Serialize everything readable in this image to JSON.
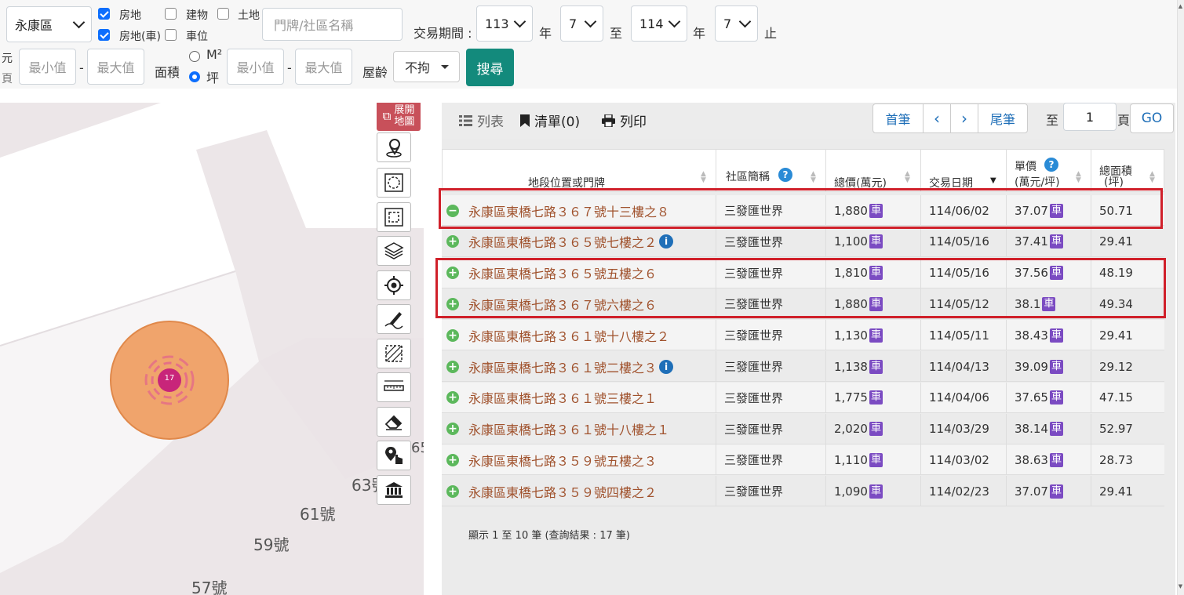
{
  "filters": {
    "district": "永康區",
    "cb_land_building": "房地",
    "cb_building": "建物",
    "cb_land": "土地",
    "cb_land_building_parking": "房地(車)",
    "cb_parking": "車位",
    "address_placeholder": "門牌/社區名稱",
    "period_label": "交易期間 :",
    "year_from": "113",
    "month_from": "7",
    "year_unit": "年",
    "to": "至",
    "year_to": "114",
    "month_to": "7",
    "end": "止",
    "price_unit_partial_1": "元",
    "price_unit_partial_2": "頁",
    "min_placeholder": "最小值",
    "max_placeholder": "最大值",
    "dash": "-",
    "area_label": "面積",
    "unit_m2": "M²",
    "unit_ping": "坪",
    "age_label": "屋齡",
    "age_value": "不拘",
    "search_button": "搜尋"
  },
  "map": {
    "expand_label_1": "展開",
    "expand_label_2": "地圖",
    "cluster_count": "17",
    "street_labels": [
      "63號",
      "61號",
      "59號",
      "57號",
      "65"
    ]
  },
  "toolbar": {
    "list_label": "列表",
    "bookmark_label": "清單(0)",
    "print_label": "列印"
  },
  "pagination": {
    "first": "首筆",
    "prev": "‹",
    "next": "›",
    "last": "尾筆",
    "to_label": "至",
    "page_value": "1",
    "page_unit": "頁",
    "go": "GO"
  },
  "table": {
    "headers": {
      "address": "地段位置或門牌",
      "community": "社區簡稱",
      "total_price": "總價(萬元)",
      "date": "交易日期",
      "unit_price_1": "單價",
      "unit_price_2": "(萬元/坪)",
      "area_1": "總面積",
      "area_2": "(坪)"
    },
    "parking_tag": "車",
    "rows": [
      {
        "address": "永康區東橋七路３６７號十三樓之８",
        "community": "三發匯世界",
        "total": "1,880",
        "date": "114/06/02",
        "unit": "37.07",
        "area": "50.71"
      },
      {
        "address": "永康區東橋七路３６５號七樓之２",
        "community": "三發匯世界",
        "total": "1,100",
        "date": "114/05/16",
        "unit": "37.41",
        "area": "29.41"
      },
      {
        "address": "永康區東橋七路３６５號五樓之６",
        "community": "三發匯世界",
        "total": "1,810",
        "date": "114/05/16",
        "unit": "37.56",
        "area": "48.19"
      },
      {
        "address": "永康區東橋七路３６７號六樓之６",
        "community": "三發匯世界",
        "total": "1,880",
        "date": "114/05/12",
        "unit": "38.1",
        "area": "49.34"
      },
      {
        "address": "永康區東橋七路３６１號十八樓之２",
        "community": "三發匯世界",
        "total": "1,130",
        "date": "114/05/11",
        "unit": "38.43",
        "area": "29.41"
      },
      {
        "address": "永康區東橋七路３６１號二樓之３",
        "community": "三發匯世界",
        "total": "1,138",
        "date": "114/04/13",
        "unit": "39.09",
        "area": "29.12"
      },
      {
        "address": "永康區東橋七路３６１號三樓之１",
        "community": "三發匯世界",
        "total": "1,775",
        "date": "114/04/06",
        "unit": "37.65",
        "area": "47.15"
      },
      {
        "address": "永康區東橋七路３６１號十八樓之１",
        "community": "三發匯世界",
        "total": "2,020",
        "date": "114/03/29",
        "unit": "38.14",
        "area": "52.97"
      },
      {
        "address": "永康區東橋七路３５９號五樓之３",
        "community": "三發匯世界",
        "total": "1,110",
        "date": "114/03/02",
        "unit": "38.63",
        "area": "28.73"
      },
      {
        "address": "永康區東橋七路３５９號四樓之２",
        "community": "三發匯世界",
        "total": "1,090",
        "date": "114/02/23",
        "unit": "37.07",
        "area": "29.41"
      }
    ],
    "footer": "顯示 1 至 10 筆 (查詢結果 : 17 筆)"
  },
  "colors": {
    "search_button": "#138a7c",
    "highlight_box": "#d0202a",
    "address_text": "#a0522d",
    "parking_tag": "#7b4bc2"
  }
}
